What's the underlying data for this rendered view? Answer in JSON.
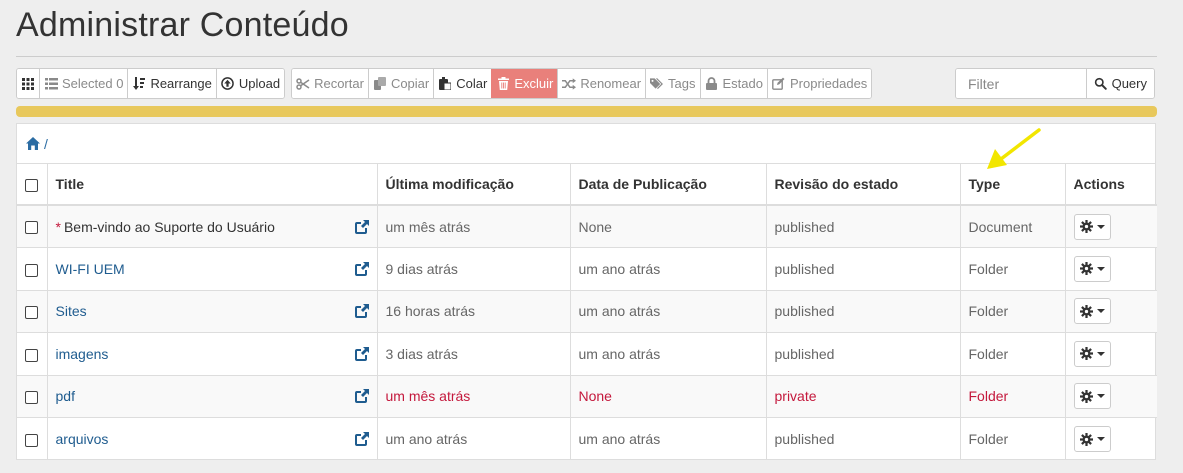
{
  "page": {
    "title": "Administrar Conteúdo"
  },
  "toolbar": {
    "group1": [
      {
        "name": "select-all-button",
        "icon": "grid-icon",
        "label": "",
        "disabled": false
      },
      {
        "name": "selected-button",
        "icon": "list-icon",
        "label": "Selected 0",
        "disabled": true
      },
      {
        "name": "rearrange-button",
        "icon": "sort-icon",
        "label": "Rearrange",
        "disabled": false
      },
      {
        "name": "upload-button",
        "icon": "upload-icon",
        "label": "Upload",
        "disabled": false
      }
    ],
    "group2": [
      {
        "name": "cut-button",
        "icon": "scissors-icon",
        "label": "Recortar",
        "disabled": true
      },
      {
        "name": "copy-button",
        "icon": "copy-icon",
        "label": "Copiar",
        "disabled": true
      },
      {
        "name": "paste-button",
        "icon": "paste-icon",
        "label": "Colar",
        "disabled": false
      },
      {
        "name": "delete-button",
        "icon": "trash-icon",
        "label": "Excluir",
        "danger": true
      },
      {
        "name": "rename-button",
        "icon": "shuffle-icon",
        "label": "Renomear",
        "disabled": true
      },
      {
        "name": "tags-button",
        "icon": "tags-icon",
        "label": "Tags",
        "disabled": true
      },
      {
        "name": "state-button",
        "icon": "lock-icon",
        "label": "Estado",
        "disabled": true
      },
      {
        "name": "properties-button",
        "icon": "edit-icon",
        "label": "Propriedades",
        "disabled": true
      }
    ]
  },
  "filter": {
    "placeholder": "Filter",
    "query_label": "Query"
  },
  "breadcrumb": {
    "root_icon": "home-icon",
    "separator": "/"
  },
  "table": {
    "columns": [
      "Title",
      "Última modificação",
      "Data de Publicação",
      "Revisão do estado",
      "Type",
      "Actions"
    ],
    "rows": [
      {
        "title": "Bem-vindo ao Suporte do Usuário",
        "required": "*",
        "modified": "um mês atrás",
        "published": "None",
        "state": "published",
        "type": "Document",
        "plain": true
      },
      {
        "title": "WI-FI UEM",
        "modified": "9 dias atrás",
        "published": "um ano atrás",
        "state": "published",
        "type": "Folder"
      },
      {
        "title": "Sites",
        "modified": "16 horas atrás",
        "published": "um ano atrás",
        "state": "published",
        "type": "Folder"
      },
      {
        "title": "imagens",
        "modified": "3 dias atrás",
        "published": "um ano atrás",
        "state": "published",
        "type": "Folder"
      },
      {
        "title": "pdf",
        "modified": "um mês atrás",
        "published": "None",
        "state": "private",
        "type": "Folder",
        "private": true
      },
      {
        "title": "arquivos",
        "modified": "um ano atrás",
        "published": "um ano atrás",
        "state": "published",
        "type": "Folder"
      }
    ]
  },
  "colors": {
    "accent_link": "#1f5c8f",
    "private": "#c4183c",
    "danger_button": "#e9807b",
    "progress": "#e8c85c",
    "arrow": "#f2e600"
  }
}
